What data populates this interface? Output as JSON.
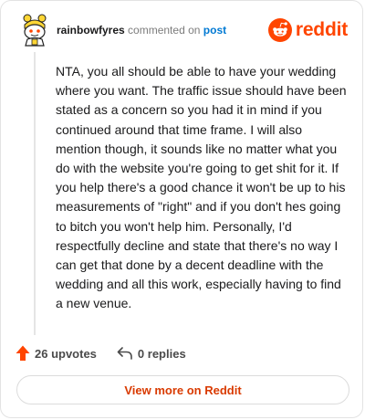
{
  "header": {
    "username": "rainbowfyres",
    "action_text": "commented on",
    "post_link": "post",
    "brand_name": "reddit"
  },
  "comment": {
    "body": "NTA, you all should be able to have your wedding where you want. The traffic issue should have been stated as a concern so you had it in mind if you continued around that time frame. I will also mention though, it sounds like no matter what you do with the website you're going to get shit for it. If you help there's a good chance it won't be up to his measurements of \"right\" and if you don't hes going to bitch you won't help him. Personally, I'd respectfully decline and state that there's no way I can get that done by a decent deadline with the wedding and all this work, especially having to find a new venue."
  },
  "actions": {
    "upvotes_label": "26 upvotes",
    "replies_label": "0 replies"
  },
  "footer": {
    "view_more_label": "View more on Reddit"
  },
  "colors": {
    "brand": "#ff4500",
    "link": "#0079d3",
    "cta_text": "#d93a00"
  },
  "icons": {
    "avatar": "snoo-avatar-icon",
    "logo": "reddit-logo-icon",
    "upvote": "upvote-arrow-icon",
    "reply": "reply-arrow-icon"
  }
}
